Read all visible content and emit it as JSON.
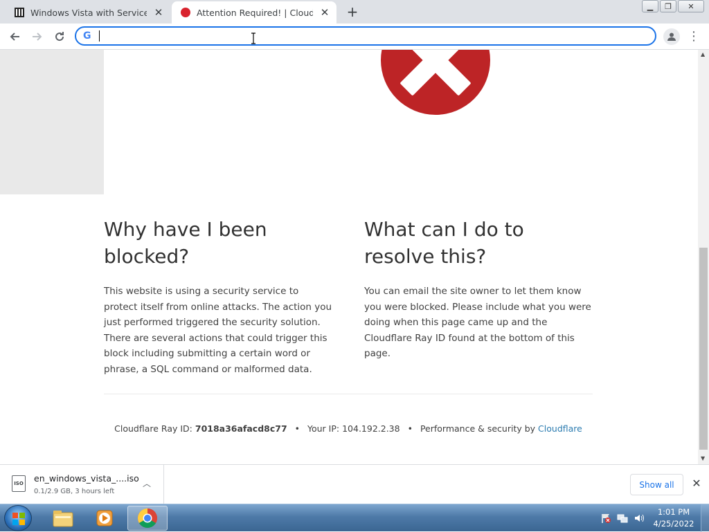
{
  "tabs": [
    {
      "title": "Windows Vista with Service Pack",
      "favicon": "archive-icon",
      "active": false
    },
    {
      "title": "Attention Required! | Cloudflare",
      "favicon": "red-circle-icon",
      "active": true
    }
  ],
  "toolbar": {
    "omnibox_value": "",
    "omnibox_icon": "google-g-icon"
  },
  "page": {
    "left_heading": "Why have I been blocked?",
    "left_text": "This website is using a security service to protect itself from online attacks. The action you just performed triggered the security solution. There are several actions that could trigger this block including submitting a certain word or phrase, a SQL command or malformed data.",
    "right_heading": "What can I do to resolve this?",
    "right_text": "You can email the site owner to let them know you were blocked. Please include what you were doing when this page came up and the Cloudflare Ray ID found at the bottom of this page.",
    "footer": {
      "ray_label": "Cloudflare Ray ID:",
      "ray_id": "7018a36afacd8c77",
      "separator": "•",
      "ip_label": "Your IP:",
      "ip": "104.192.2.38",
      "perf_label": "Performance & security by",
      "cf_link": "Cloudflare"
    },
    "error_color": "#bd2426"
  },
  "download": {
    "filename": "en_windows_vista_....iso",
    "status": "0.1/2.9 GB, 3 hours left",
    "icon_label": "ISO",
    "show_all": "Show all"
  },
  "taskbar": {
    "time": "1:01 PM",
    "date": "4/25/2022",
    "pinned": [
      "explorer-icon",
      "media-player-icon",
      "chrome-icon"
    ]
  }
}
